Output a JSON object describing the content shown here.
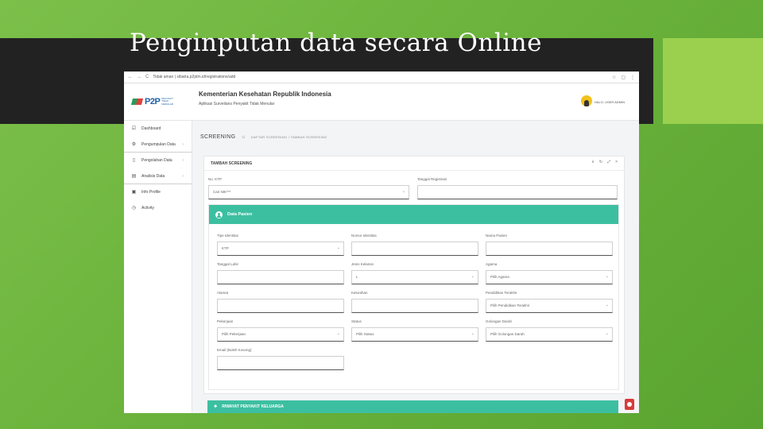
{
  "slide": {
    "title": "Penginputan data secara Online"
  },
  "browser": {
    "url": "Tidak aman | sibatra.p2ptm.id/registrations/add",
    "nav_back": "←",
    "nav_forward": "→",
    "nav_reload": "C"
  },
  "header": {
    "logo_text": "P2P",
    "logo_sub": "PENYAKIT TIDAK MENULAR",
    "title": "Kementerian Kesehatan Republik Indonesia",
    "subtitle": "Aplikasi Surveilans Penyakit Tidak Menular",
    "user_name": "HALO, USER ADMIN"
  },
  "sidebar": {
    "items": [
      {
        "label": "Dashboard",
        "icon": "checkbox-icon"
      },
      {
        "label": "Pengumpulan Data",
        "icon": "gear-icon"
      },
      {
        "label": "Pengolahan Data",
        "icon": "file-icon"
      },
      {
        "label": "Analisis Data",
        "icon": "chart-icon"
      },
      {
        "label": "Info Profile",
        "icon": "profile-icon"
      },
      {
        "label": "Activity",
        "icon": "clock-icon"
      }
    ]
  },
  "breadcrumb": {
    "title": "SCREENING",
    "path": "DAFTAR SCREENING  /  TAMBAH SCREENING"
  },
  "card": {
    "title": "TAMBAH SCREENING",
    "nik_label": "No. KTP",
    "nik_value": "Cari NIK***",
    "date_label": "Tanggal Registrasi",
    "date_value": ""
  },
  "patient": {
    "title": "Data Pasien",
    "fields": {
      "tipe": {
        "label": "Tipe Identitas",
        "value": "KTP"
      },
      "nomor": {
        "label": "Nomor Identitas",
        "value": ""
      },
      "nama": {
        "label": "Nama Pasien",
        "value": ""
      },
      "tgl_lahir": {
        "label": "Tanggal Lahir",
        "value": ""
      },
      "jk": {
        "label": "Jenis Kelamin",
        "value": "L"
      },
      "agama": {
        "label": "Agama",
        "value": "Pilih Agama"
      },
      "alamat": {
        "label": "Alamat",
        "value": ""
      },
      "kelurahan": {
        "label": "Kelurahan",
        "value": ""
      },
      "pendidikan": {
        "label": "Pendidikan Terakhir",
        "value": "Pilih Pendidikan Terakhir"
      },
      "pekerjaan": {
        "label": "Pekerjaan",
        "value": "Pilih Pekerjaan"
      },
      "status": {
        "label": "Status",
        "value": "Pilih Status"
      },
      "golongan": {
        "label": "Golongan Darah",
        "value": "Pilih Golongan Darah"
      },
      "email": {
        "label": "Email (Boleh Kosong)",
        "value": ""
      }
    }
  },
  "family": {
    "title": "RIWAYAT PENYAKIT KELUARGA"
  },
  "colors": {
    "teal": "#3cbfa1",
    "band": "#222222",
    "slide_green": "#6bb33c"
  }
}
